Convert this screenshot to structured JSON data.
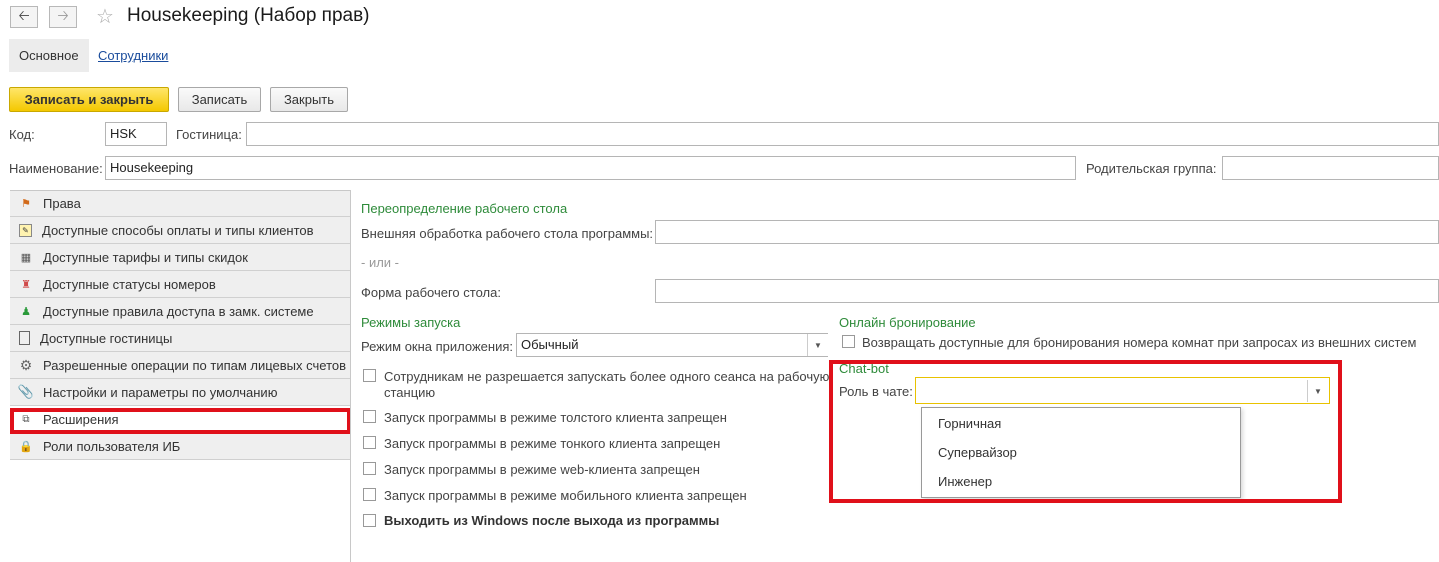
{
  "header": {
    "back_icon": "arrow-left-icon",
    "forward_icon": "arrow-right-icon",
    "star_icon": "star-icon",
    "title": "Housekeeping (Набор прав)"
  },
  "tabs": [
    {
      "label": "Основное"
    },
    {
      "label": "Сотрудники"
    }
  ],
  "toolbar": {
    "save_close": "Записать и закрыть",
    "save": "Записать",
    "close": "Закрыть"
  },
  "form": {
    "code_label": "Код:",
    "code_value": "HSK",
    "hotel_label": "Гостиница:",
    "hotel_value": "",
    "name_label": "Наименование:",
    "name_value": "Housekeeping",
    "parent_label": "Родительская группа:",
    "parent_value": ""
  },
  "sidebar": {
    "items": [
      {
        "label": "Права",
        "icon": "rights-icon"
      },
      {
        "label": "Доступные способы оплаты и типы клиентов",
        "icon": "payment-icon"
      },
      {
        "label": "Доступные тарифы и типы скидок",
        "icon": "calculator-icon"
      },
      {
        "label": "Доступные статусы номеров",
        "icon": "room-status-icon"
      },
      {
        "label": "Доступные правила доступа в замк. системе",
        "icon": "user-lock-icon"
      },
      {
        "label": "Доступные гостиницы",
        "icon": "document-icon"
      },
      {
        "label": "Разрешенные операции по типам лицевых счетов",
        "icon": "gear-icon"
      },
      {
        "label": "Настройки и параметры по умолчанию",
        "icon": "paperclip-icon"
      },
      {
        "label": "Расширения",
        "icon": "extension-icon"
      },
      {
        "label": "Роли пользователя ИБ",
        "icon": "user-role-icon"
      }
    ]
  },
  "main": {
    "desktop_section": "Переопределение рабочего стола",
    "external_processing_label": "Внешняя обработка рабочего стола программы:",
    "or_text": "- или -",
    "desktop_form_label": "Форма рабочего стола:",
    "launch_section": "Режимы запуска",
    "app_mode_label": "Режим окна приложения:",
    "app_mode_value": "Обычный",
    "checkboxes": [
      {
        "label": "Сотрудникам не разрешается запускать более одного сеанса на рабочую",
        "label2": "станцию",
        "checked": false
      },
      {
        "label": "Запуск программы в режиме толстого клиента запрещен",
        "checked": false
      },
      {
        "label": "Запуск программы в режиме тонкого клиента запрещен",
        "checked": false
      },
      {
        "label": "Запуск программы в режиме web-клиента запрещен",
        "checked": false
      },
      {
        "label": "Запуск программы в режиме мобильного клиента запрещен",
        "checked": false
      },
      {
        "label": "Выходить из Windows после выхода из программы",
        "checked": false
      }
    ],
    "online_section": "Онлайн бронирование",
    "online_checkbox": "Возвращать доступные для бронирования номера комнат при запросах из внешних систем",
    "chatbot_section": "Chat-bot",
    "chat_role_label": "Роль в чате:",
    "chat_role_value": "",
    "chat_role_options": [
      "Горничная",
      "Супервайзор",
      "Инженер"
    ]
  },
  "colors": {
    "accent_yellow": "#f4c800",
    "section_green": "#2e8b3a",
    "highlight_red": "#e0101a",
    "link_blue": "#1a4c9c"
  }
}
